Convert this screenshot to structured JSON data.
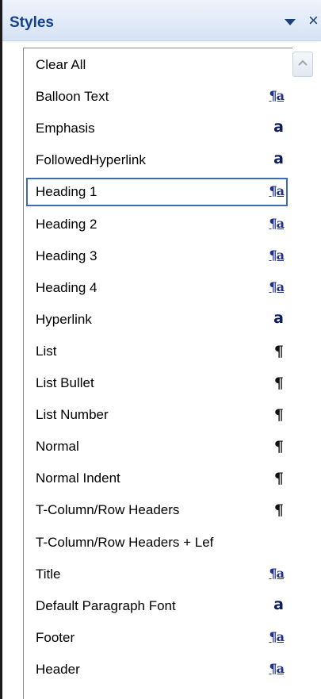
{
  "panel": {
    "title": "Styles",
    "close_glyph": "×"
  },
  "colors": {
    "title_text": "#15428b",
    "selection_border": "#3c6ab5",
    "glyph_blue": "#1f2f8a"
  },
  "styles": [
    {
      "label": "Clear All",
      "icon": "none",
      "glyph": ""
    },
    {
      "label": "Balloon Text",
      "icon": "paragraph-character-icon",
      "glyph": "¶a"
    },
    {
      "label": "Emphasis",
      "icon": "character-style-icon",
      "glyph": "a"
    },
    {
      "label": "FollowedHyperlink",
      "icon": "character-style-icon",
      "glyph": "a"
    },
    {
      "label": "Heading 1",
      "icon": "paragraph-character-icon",
      "glyph": "¶a",
      "selected": true
    },
    {
      "label": "Heading 2",
      "icon": "paragraph-character-icon",
      "glyph": "¶a"
    },
    {
      "label": "Heading 3",
      "icon": "paragraph-character-icon",
      "glyph": "¶a"
    },
    {
      "label": "Heading 4",
      "icon": "paragraph-character-icon",
      "glyph": "¶a"
    },
    {
      "label": "Hyperlink",
      "icon": "character-style-icon",
      "glyph": "a"
    },
    {
      "label": "List",
      "icon": "paragraph-style-icon",
      "glyph": "¶"
    },
    {
      "label": "List Bullet",
      "icon": "paragraph-style-icon",
      "glyph": "¶"
    },
    {
      "label": "List Number",
      "icon": "paragraph-style-icon",
      "glyph": "¶"
    },
    {
      "label": "Normal",
      "icon": "paragraph-style-icon",
      "glyph": "¶"
    },
    {
      "label": "Normal Indent",
      "icon": "paragraph-style-icon",
      "glyph": "¶"
    },
    {
      "label": "T-Column/Row Headers",
      "icon": "paragraph-style-icon",
      "glyph": "¶"
    },
    {
      "label": "T-Column/Row Headers + Lef",
      "icon": "none",
      "glyph": ""
    },
    {
      "label": "Title",
      "icon": "paragraph-character-icon",
      "glyph": "¶a"
    },
    {
      "label": "Default Paragraph Font",
      "icon": "character-style-icon",
      "glyph": "a"
    },
    {
      "label": "Footer",
      "icon": "paragraph-character-icon",
      "glyph": "¶a"
    },
    {
      "label": "Header",
      "icon": "paragraph-character-icon",
      "glyph": "¶a"
    }
  ]
}
